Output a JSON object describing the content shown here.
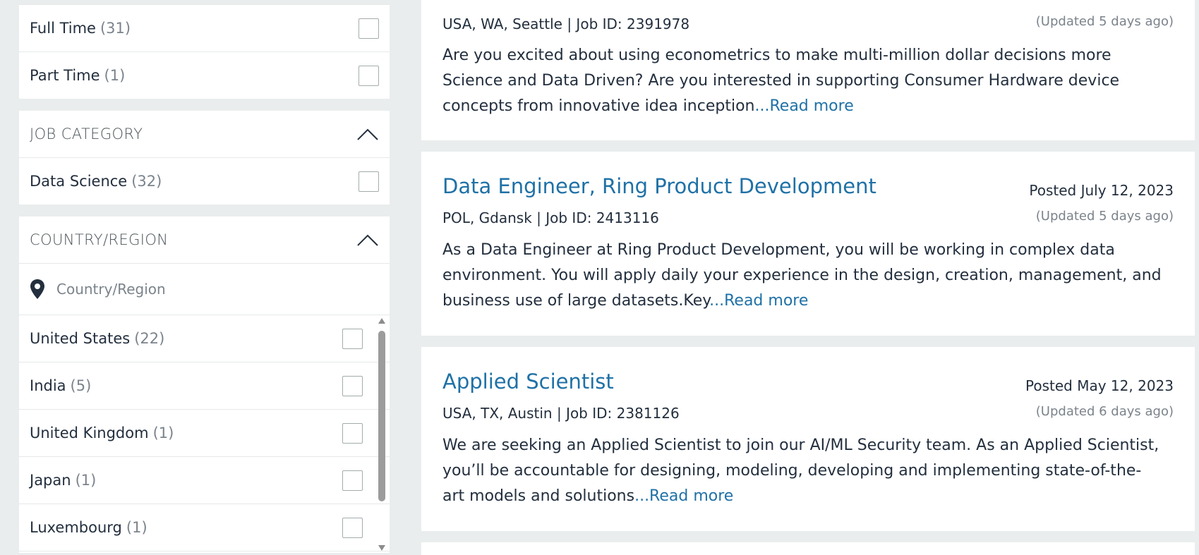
{
  "filters": {
    "job_type": {
      "items": [
        {
          "label": "Full Time",
          "count": "(31)"
        },
        {
          "label": "Part Time",
          "count": "(1)"
        }
      ]
    },
    "job_category": {
      "header": "JOB CATEGORY",
      "items": [
        {
          "label": "Data Science",
          "count": "(32)"
        }
      ]
    },
    "country_region": {
      "header": "COUNTRY/REGION",
      "search_placeholder": "Country/Region",
      "items": [
        {
          "label": "United States",
          "count": "(22)"
        },
        {
          "label": "India",
          "count": "(5)"
        },
        {
          "label": "United Kingdom",
          "count": "(1)"
        },
        {
          "label": "Japan",
          "count": "(1)"
        },
        {
          "label": "Luxembourg",
          "count": "(1)"
        }
      ]
    }
  },
  "jobs": [
    {
      "location_id": "USA, WA, Seattle | Job ID: 2391978",
      "updated": "(Updated 5 days ago)",
      "description": "Are you excited about using econometrics to make multi-million dollar decisions more Science and Data Driven? Are you interested in supporting Consumer Hardware device concepts from innovative idea inception",
      "read_more": "...Read more"
    },
    {
      "title": "Data Engineer, Ring Product Development",
      "posted": "Posted July 12, 2023",
      "location_id": "POL, Gdansk | Job ID: 2413116",
      "updated": "(Updated 5 days ago)",
      "description": "As a Data Engineer at Ring Product Development, you will be working in complex data environment. You will apply daily your experience in the design, creation, management, and business use of large datasets.Key",
      "read_more": "...Read more"
    },
    {
      "title": "Applied Scientist",
      "posted": "Posted May 12, 2023",
      "location_id": "USA, TX, Austin | Job ID: 2381126",
      "updated": "(Updated 6 days ago)",
      "description": "We are seeking an Applied Scientist to join our AI/ML Security team. As an Applied Scientist, you’ll be accountable for designing, modeling, developing and implementing state-of-the-art models and solutions",
      "read_more": "...Read more"
    }
  ]
}
